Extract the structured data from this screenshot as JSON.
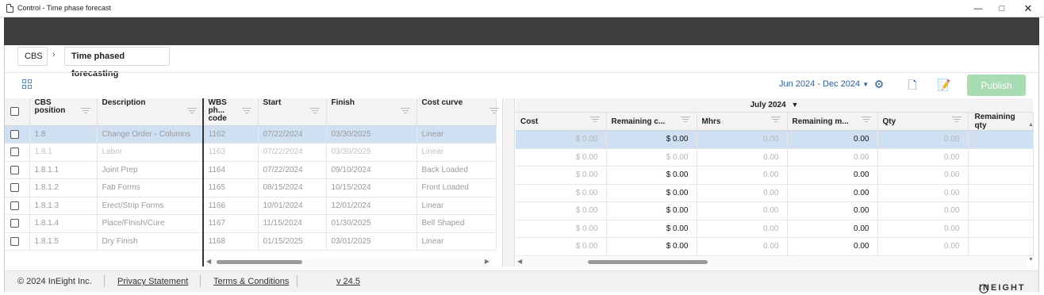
{
  "window": {
    "title": "Control - Time phase forecast"
  },
  "breadcrumb": {
    "root": "CBS",
    "current": "Time phased forecasting"
  },
  "toolbar": {
    "date_range": "Jun 2024 - Dec 2024",
    "publish_label": "Publish"
  },
  "left_grid": {
    "headers": {
      "cbs": [
        "CBS",
        "position"
      ],
      "description": "Description",
      "wbs": [
        "WBS",
        "ph...",
        "code"
      ],
      "start": "Start",
      "finish": "Finish",
      "curve": "Cost curve"
    },
    "rows": [
      {
        "cbs": "1.8",
        "description": "Change Order - Columns",
        "wbs": "1162",
        "start": "07/22/2024",
        "finish": "03/30/2025",
        "curve": "Linear"
      },
      {
        "cbs": "1.8.1",
        "description": "Labor",
        "wbs": "1163",
        "start": "07/22/2024",
        "finish": "03/30/2025",
        "curve": "Linear"
      },
      {
        "cbs": "1.8.1.1",
        "description": "Joint Prep",
        "wbs": "1164",
        "start": "07/22/2024",
        "finish": "09/10/2024",
        "curve": "Back Loaded"
      },
      {
        "cbs": "1.8.1.2",
        "description": "Fab Forms",
        "wbs": "1165",
        "start": "08/15/2024",
        "finish": "10/15/2024",
        "curve": "Front Loaded"
      },
      {
        "cbs": "1.8.1.3",
        "description": "Erect/Strip Forms",
        "wbs": "1166",
        "start": "10/01/2024",
        "finish": "12/01/2024",
        "curve": "Linear"
      },
      {
        "cbs": "1.8.1.4",
        "description": "Place/Finish/Cure",
        "wbs": "1167",
        "start": "11/15/2024",
        "finish": "01/30/2025",
        "curve": "Bell Shaped"
      },
      {
        "cbs": "1.8.1.5",
        "description": "Dry Finish",
        "wbs": "1168",
        "start": "01/15/2025",
        "finish": "03/01/2025",
        "curve": "Linear"
      }
    ]
  },
  "right_grid": {
    "month": "July 2024",
    "headers": {
      "cost": "Cost",
      "rem_cost": "Remaining c...",
      "mhrs": "Mhrs",
      "rem_mhrs": "Remaining m...",
      "qty": "Qty",
      "rem_qty": "Remaining qty"
    },
    "rows": [
      {
        "cost": "$ 0.00",
        "rem_cost": "$ 0.00",
        "mhrs": "0.00",
        "rem_mhrs": "0.00",
        "qty": "0.00"
      },
      {
        "cost": "$ 0.00",
        "rem_cost": "$ 0.00",
        "mhrs": "0.00",
        "rem_mhrs": "0.00",
        "qty": "0.00"
      },
      {
        "cost": "$ 0.00",
        "rem_cost": "$ 0.00",
        "mhrs": "0.00",
        "rem_mhrs": "0.00",
        "qty": "0.00"
      },
      {
        "cost": "$ 0.00",
        "rem_cost": "$ 0.00",
        "mhrs": "0.00",
        "rem_mhrs": "0.00",
        "qty": "0.00"
      },
      {
        "cost": "$ 0.00",
        "rem_cost": "$ 0.00",
        "mhrs": "0.00",
        "rem_mhrs": "0.00",
        "qty": "0.00"
      },
      {
        "cost": "$ 0.00",
        "rem_cost": "$ 0.00",
        "mhrs": "0.00",
        "rem_mhrs": "0.00",
        "qty": "0.00"
      },
      {
        "cost": "$ 0.00",
        "rem_cost": "$ 0.00",
        "mhrs": "0.00",
        "rem_mhrs": "0.00",
        "qty": "0.00"
      }
    ]
  },
  "footer": {
    "copyright": "© 2024 InEight Inc.",
    "privacy": "Privacy Statement",
    "terms": "Terms & Conditions",
    "version": "v 24.5",
    "logo": "INEIGHT"
  }
}
